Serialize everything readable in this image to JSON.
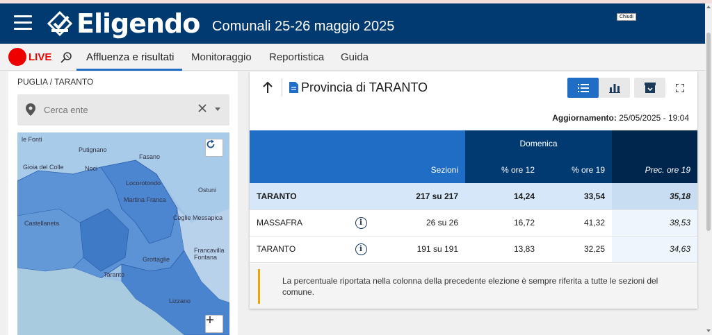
{
  "header": {
    "logo_text": "Eligendo",
    "election_title": "Comunali 25-26 maggio 2025",
    "close_label": "Chiudi"
  },
  "nav": {
    "live_label": "LIVE",
    "items": [
      "Affluenza e risultati",
      "Monitoraggio",
      "Reportistica",
      "Guida"
    ]
  },
  "sidebar": {
    "breadcrumb": "PUGLIA / TARANTO",
    "search_placeholder": "Cerca ente",
    "map_labels": [
      "le Fonti",
      "Putignano",
      "Gioia del Colle",
      "Noci",
      "Fasano",
      "Locorotondo",
      "Ostuni",
      "Martina Franca",
      "Castellaneta",
      "Ceglie Messapica",
      "Francavilla Fontana",
      "Grottaglie",
      "Taranto",
      "Lizzano"
    ]
  },
  "panel": {
    "title": "Provincia di TARANTO",
    "update_label": "Aggiornamento:",
    "update_value": "25/05/2025 - 19:04",
    "colors": {
      "accent": "#1f6dc5",
      "dark": "#003a70",
      "navy": "#00264d",
      "warning": "#f0a500"
    }
  },
  "table": {
    "group_header": "Domenica",
    "columns": {
      "sezioni": "Sezioni",
      "ore12": "% ore 12",
      "ore19": "% ore 19",
      "prec": "Prec. ore 19"
    },
    "total": {
      "name": "TARANTO",
      "sezioni": "217 su 217",
      "ore12": "14,24",
      "ore19": "33,54",
      "prec": "35,18"
    },
    "rows": [
      {
        "name": "MASSAFRA",
        "sezioni": "26 su 26",
        "ore12": "16,72",
        "ore19": "41,32",
        "prec": "38,53"
      },
      {
        "name": "TARANTO",
        "sezioni": "191 su 191",
        "ore12": "13,83",
        "ore19": "32,25",
        "prec": "34,63"
      }
    ]
  },
  "note": {
    "text": "La percentuale riportata nella colonna della precedente elezione è sempre riferita a tutte le sezioni del comune."
  }
}
